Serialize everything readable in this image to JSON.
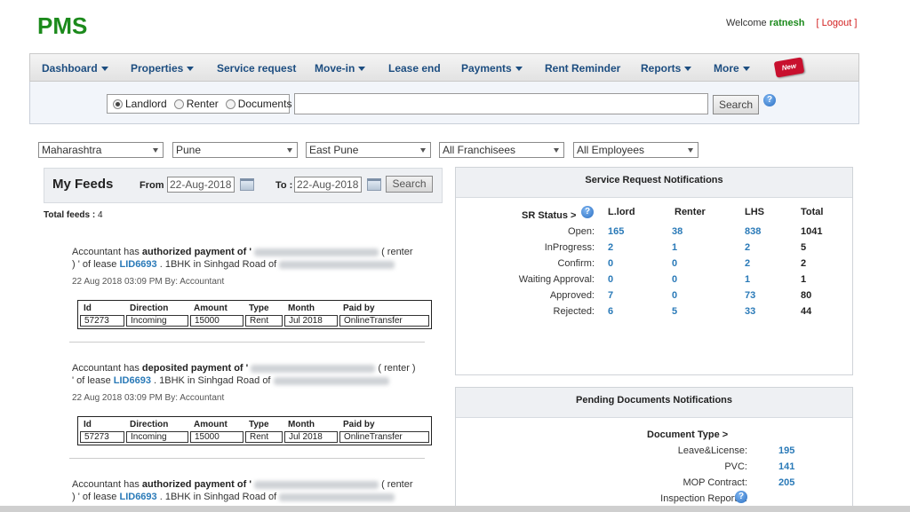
{
  "app": {
    "logo": "PMS"
  },
  "user": {
    "welcome": "Welcome",
    "name": "ratnesh",
    "logout": "Logout",
    "bracket_open": "[",
    "bracket_close": "]"
  },
  "nav": {
    "dashboard": "Dashboard",
    "properties": "Properties",
    "service_request": "Service request",
    "move_in": "Move-in",
    "lease_end": "Lease end",
    "payments": "Payments",
    "rent_reminder": "Rent Reminder",
    "reports": "Reports",
    "more": "More",
    "new_badge": "New"
  },
  "search": {
    "options": [
      "Landlord",
      "Renter",
      "Documents"
    ],
    "selected": "Landlord",
    "value": "",
    "button": "Search",
    "help_icon": "question-circle-icon"
  },
  "filters": {
    "state": "Maharashtra",
    "city": "Pune",
    "area": "East Pune",
    "franchisee": "All Franchisees",
    "employee": "All Employees"
  },
  "feeds": {
    "title": "My Feeds",
    "from_label": "From :",
    "from_date": "22-Aug-2018",
    "to_label": "To :",
    "to_date": "22-Aug-2018",
    "search_button": "Search",
    "total_label": "Total feeds :",
    "total_value": "4",
    "table_headers": [
      "Id",
      "Direction",
      "Amount",
      "Type",
      "Month",
      "Paid by"
    ],
    "items": [
      {
        "prefix": "Accountant has",
        "action": "authorized payment of",
        "quote_open": "'",
        "renter_suffix": "( renter",
        "line2_prefix": ") ' of lease",
        "lease": "LID6693",
        "lease_suffix": ". 1BHK in Sinhgad Road of",
        "meta": "22 Aug 2018 03:09 PM By: Accountant",
        "row": [
          "57273",
          "Incoming",
          "15000",
          "Rent",
          "Jul 2018",
          "OnlineTransfer"
        ]
      },
      {
        "prefix": "Accountant has",
        "action": "deposited payment of",
        "quote_open": "'",
        "renter_suffix": "( renter )",
        "line2_prefix": "' of lease",
        "lease": "LID6693",
        "lease_suffix": ". 1BHK in Sinhgad Road of",
        "meta": "22 Aug 2018 03:09 PM By: Accountant",
        "row": [
          "57273",
          "Incoming",
          "15000",
          "Rent",
          "Jul 2018",
          "OnlineTransfer"
        ]
      },
      {
        "prefix": "Accountant has",
        "action": "authorized payment of",
        "quote_open": "'",
        "renter_suffix": "( renter",
        "line2_prefix": ") ' of lease",
        "lease": "LID6693",
        "lease_suffix": ". 1BHK in Sinhgad Road of"
      }
    ]
  },
  "sr": {
    "title": "Service Request Notifications",
    "status_label": "SR Status >",
    "headers": [
      "L.lord",
      "Renter",
      "LHS",
      "Total"
    ],
    "rows": [
      {
        "label": "Open:",
        "vals": [
          "165",
          "38",
          "838",
          "1041"
        ]
      },
      {
        "label": "InProgress:",
        "vals": [
          "2",
          "1",
          "2",
          "5"
        ]
      },
      {
        "label": "Confirm:",
        "vals": [
          "0",
          "0",
          "2",
          "2"
        ]
      },
      {
        "label": "Waiting Approval:",
        "vals": [
          "0",
          "0",
          "1",
          "1"
        ]
      },
      {
        "label": "Approved:",
        "vals": [
          "7",
          "0",
          "73",
          "80"
        ]
      },
      {
        "label": "Rejected:",
        "vals": [
          "6",
          "5",
          "33",
          "44"
        ]
      }
    ]
  },
  "docs": {
    "title": "Pending Documents Notifications",
    "type_label": "Document Type >",
    "rows": [
      {
        "label": "Leave&License:",
        "val": "195"
      },
      {
        "label": "PVC:",
        "val": "141"
      },
      {
        "label": "MOP Contract:",
        "val": "205"
      },
      {
        "label": "Inspection Reports :",
        "val": ""
      }
    ]
  }
}
